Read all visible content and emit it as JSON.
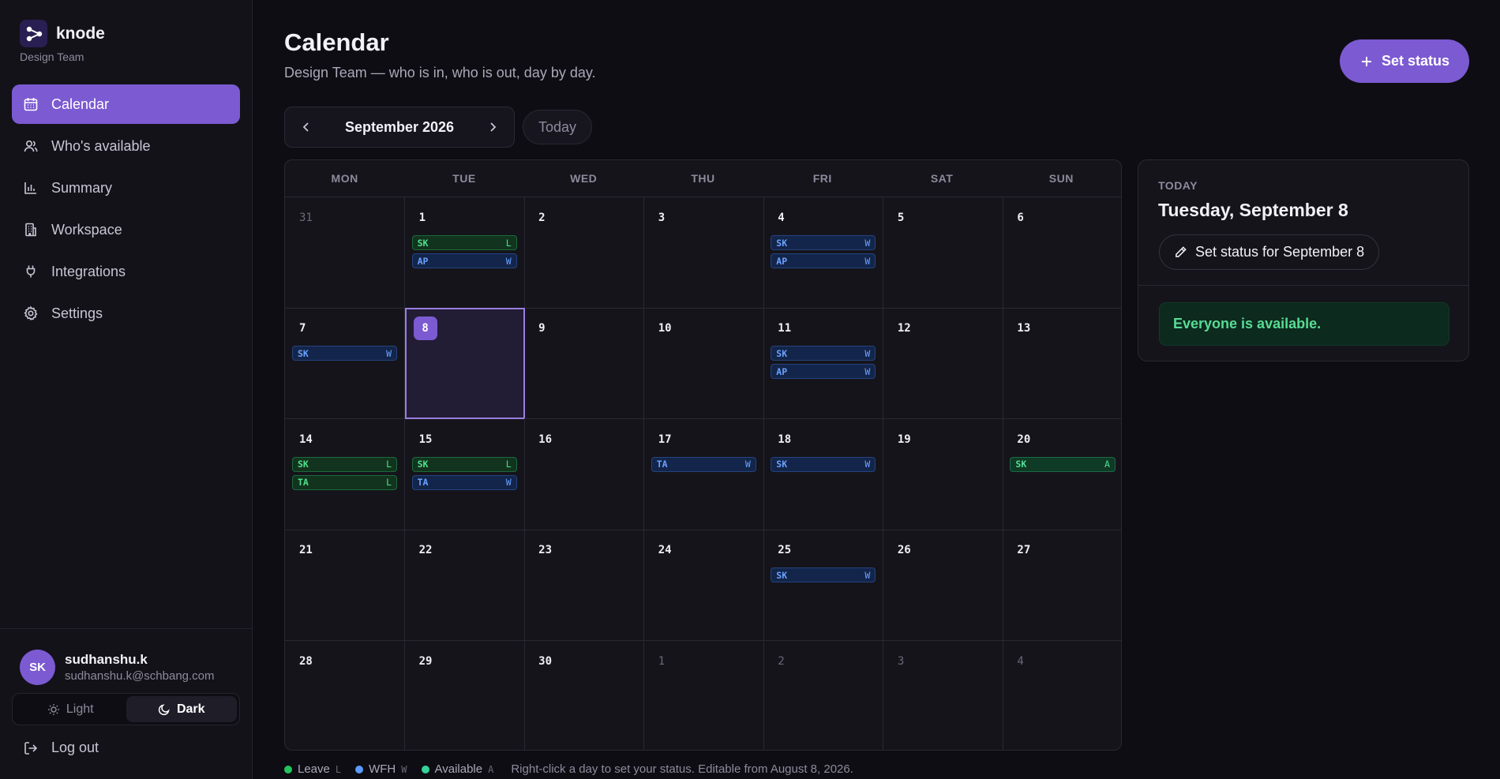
{
  "brand": {
    "name": "knode",
    "team": "Design Team"
  },
  "nav": [
    {
      "label": "Calendar",
      "icon": "calendar-icon",
      "active": true
    },
    {
      "label": "Who's available",
      "icon": "users-icon"
    },
    {
      "label": "Summary",
      "icon": "bar-chart-icon"
    },
    {
      "label": "Workspace",
      "icon": "building-icon"
    },
    {
      "label": "Integrations",
      "icon": "plug-icon"
    },
    {
      "label": "Settings",
      "icon": "gear-icon"
    }
  ],
  "user": {
    "initials": "SK",
    "name": "sudhanshu.k",
    "email": "sudhanshu.k@schbang.com"
  },
  "theme": {
    "light_label": "Light",
    "dark_label": "Dark",
    "selected": "Dark"
  },
  "logout_label": "Log out",
  "header": {
    "title": "Calendar",
    "subtitle": "Design Team — who is in, who is out, day by day.",
    "set_status_label": "Set status"
  },
  "month_nav": {
    "label": "September 2026",
    "today_label": "Today"
  },
  "calendar": {
    "weekdays": [
      "MON",
      "TUE",
      "WED",
      "THU",
      "FRI",
      "SAT",
      "SUN"
    ],
    "days": [
      {
        "n": "31",
        "out": true
      },
      {
        "n": "1",
        "chips": [
          [
            "SK",
            "L"
          ],
          [
            "AP",
            "W"
          ]
        ]
      },
      {
        "n": "2"
      },
      {
        "n": "3"
      },
      {
        "n": "4",
        "chips": [
          [
            "SK",
            "W"
          ],
          [
            "AP",
            "W"
          ]
        ]
      },
      {
        "n": "5"
      },
      {
        "n": "6"
      },
      {
        "n": "7",
        "chips": [
          [
            "SK",
            "W"
          ]
        ]
      },
      {
        "n": "8",
        "today": true
      },
      {
        "n": "9"
      },
      {
        "n": "10"
      },
      {
        "n": "11",
        "chips": [
          [
            "SK",
            "W"
          ],
          [
            "AP",
            "W"
          ]
        ]
      },
      {
        "n": "12"
      },
      {
        "n": "13"
      },
      {
        "n": "14",
        "chips": [
          [
            "SK",
            "L"
          ],
          [
            "TA",
            "L"
          ]
        ]
      },
      {
        "n": "15",
        "chips": [
          [
            "SK",
            "L"
          ],
          [
            "TA",
            "W"
          ]
        ]
      },
      {
        "n": "16"
      },
      {
        "n": "17",
        "chips": [
          [
            "TA",
            "W"
          ]
        ]
      },
      {
        "n": "18",
        "chips": [
          [
            "SK",
            "W"
          ]
        ]
      },
      {
        "n": "19"
      },
      {
        "n": "20",
        "chips": [
          [
            "SK",
            "A"
          ]
        ]
      },
      {
        "n": "21"
      },
      {
        "n": "22"
      },
      {
        "n": "23"
      },
      {
        "n": "24"
      },
      {
        "n": "25",
        "chips": [
          [
            "SK",
            "W"
          ]
        ]
      },
      {
        "n": "26"
      },
      {
        "n": "27"
      },
      {
        "n": "28"
      },
      {
        "n": "29"
      },
      {
        "n": "30"
      },
      {
        "n": "1",
        "out": true
      },
      {
        "n": "2",
        "out": true
      },
      {
        "n": "3",
        "out": true
      },
      {
        "n": "4",
        "out": true
      }
    ]
  },
  "legend": {
    "items": [
      {
        "label": "Leave",
        "code": "L",
        "color": "#22c55e"
      },
      {
        "label": "WFH",
        "code": "W",
        "color": "#5b9bff"
      },
      {
        "label": "Available",
        "code": "A",
        "color": "#34d399"
      }
    ],
    "hint": "Right-click a day to set your status. Editable from August 8, 2026."
  },
  "panel": {
    "eyebrow": "TODAY",
    "date": "Tuesday, September 8",
    "set_status_label": "Set status for September 8",
    "availability": "Everyone is available."
  }
}
